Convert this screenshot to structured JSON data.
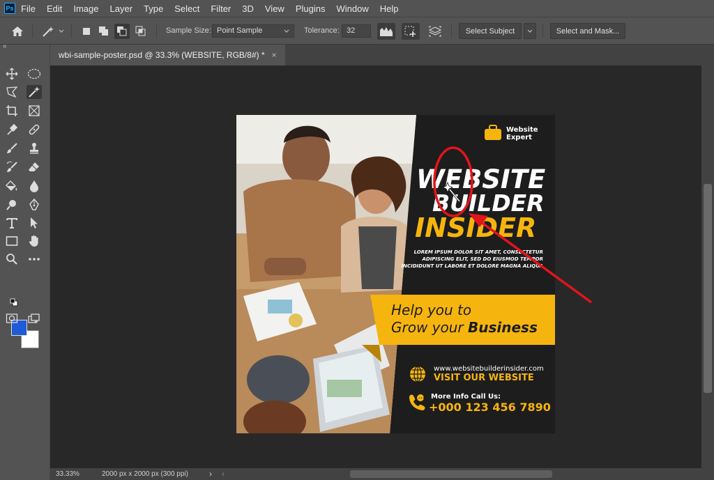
{
  "menu": {
    "logo": "Ps",
    "items": [
      "File",
      "Edit",
      "Image",
      "Layer",
      "Type",
      "Select",
      "Filter",
      "3D",
      "View",
      "Plugins",
      "Window",
      "Help"
    ]
  },
  "options": {
    "sample_size_label": "Sample Size:",
    "sample_size_value": "Point Sample",
    "tolerance_label": "Tolerance:",
    "tolerance_value": "32",
    "select_subject": "Select Subject",
    "select_and_mask": "Select and Mask..."
  },
  "panel_collapse": "«",
  "document": {
    "tab_title": "wbi-sample-poster.psd @ 33.3% (WEBSITE, RGB/8#) *",
    "close": "×"
  },
  "colors": {
    "foreground": "#1f5bd6",
    "background": "#ffffff",
    "accent_yellow": "#f6b50e",
    "annotation_red": "#e3141b"
  },
  "poster": {
    "brand_line1": "Website",
    "brand_line2": "Expert",
    "headline1": "WEBSITE",
    "headline2": "BUILDER",
    "headline3": "INSIDER",
    "lorem1": "LOREM IPSUM DOLOR SIT AMET, CONSECTETUR",
    "lorem2": "ADIPISCING ELIT, SED DO EIUSMOD TEMPOR",
    "lorem3": "INCIDIDUNT UT LABORE ET DOLORE MAGNA ALIQUA",
    "banner_line1": "Help you to",
    "banner_line2a": "Grow your ",
    "banner_line2b": "Business",
    "url": "www.websitebuilderinsider.com",
    "visit": "VISIT OUR WEBSITE",
    "call_label": "More Info Call Us:",
    "phone": "+000 123 456 7890"
  },
  "status": {
    "zoom": "33.33%",
    "doc_info": "2000 px x 2000 px (300 ppi)",
    "arrow": "›",
    "left_arrow": "‹"
  },
  "tools": [
    "move-icon",
    "elliptical-marquee-icon",
    "polygonal-lasso-icon",
    "magic-wand-icon",
    "crop-icon",
    "frame-icon",
    "eyedropper-icon",
    "healing-brush-icon",
    "brush-icon",
    "clone-stamp-icon",
    "history-brush-icon",
    "eraser-icon",
    "paint-bucket-icon",
    "blur-icon",
    "dodge-icon",
    "pen-icon",
    "type-icon",
    "path-selection-icon",
    "rectangle-icon",
    "hand-icon",
    "zoom-icon",
    "more-tools-icon"
  ]
}
